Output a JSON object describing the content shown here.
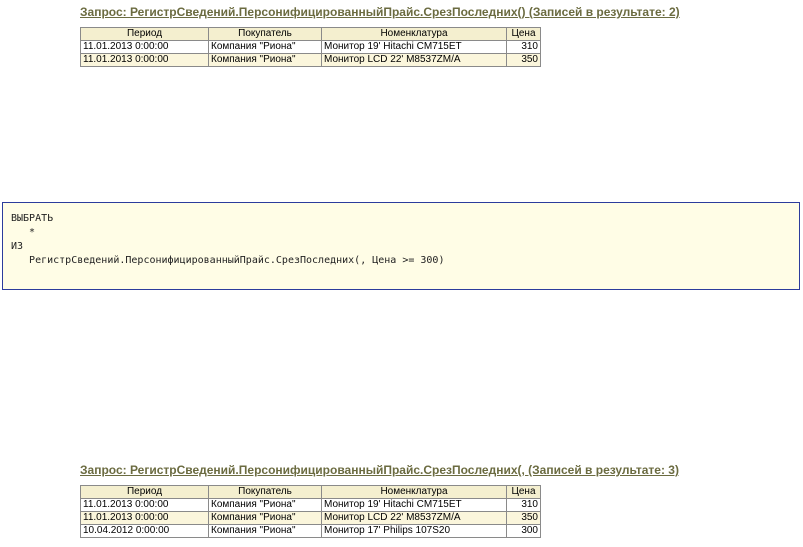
{
  "query1": {
    "title": "Запрос: РегистрСведений.ПерсонифицированныйПрайс.СрезПоследних() (Записей в результате: 2)",
    "headers": [
      "Период",
      "Покупатель",
      "Номенклатура",
      "Цена"
    ],
    "rows": [
      [
        "11.01.2013 0:00:00",
        "Компания \"Риона\"",
        "Монитор 19' Hitachi CM715ET",
        "310"
      ],
      [
        "11.01.2013 0:00:00",
        "Компания \"Риона\"",
        "Монитор LCD 22' M8537ZM/A",
        "350"
      ]
    ]
  },
  "code": {
    "lines": [
      "ВЫБРАТЬ",
      "   *",
      "ИЗ",
      "   РегистрСведений.ПерсонифицированныйПрайс.СрезПоследних(, Цена >= 300)"
    ]
  },
  "query2": {
    "title": "Запрос: РегистрСведений.ПерсонифицированныйПрайс.СрезПоследних(, (Записей в результате: 3)",
    "headers": [
      "Период",
      "Покупатель",
      "Номенклатура",
      "Цена"
    ],
    "rows": [
      [
        "11.01.2013 0:00:00",
        "Компания \"Риона\"",
        "Монитор 19' Hitachi CM715ET",
        "310"
      ],
      [
        "11.01.2013 0:00:00",
        "Компания \"Риона\"",
        "Монитор LCD 22' M8537ZM/A",
        "350"
      ],
      [
        "10.04.2012 0:00:00",
        "Компания \"Риона\"",
        "Монитор 17' Philips 107S20",
        "300"
      ]
    ]
  },
  "colors": {
    "header_bg": "#f4efcf",
    "row_alt_bg": "#fbf6dc",
    "title_color": "#6b6b40",
    "code_border": "#2c3c9c",
    "code_bg": "#fffde6"
  }
}
